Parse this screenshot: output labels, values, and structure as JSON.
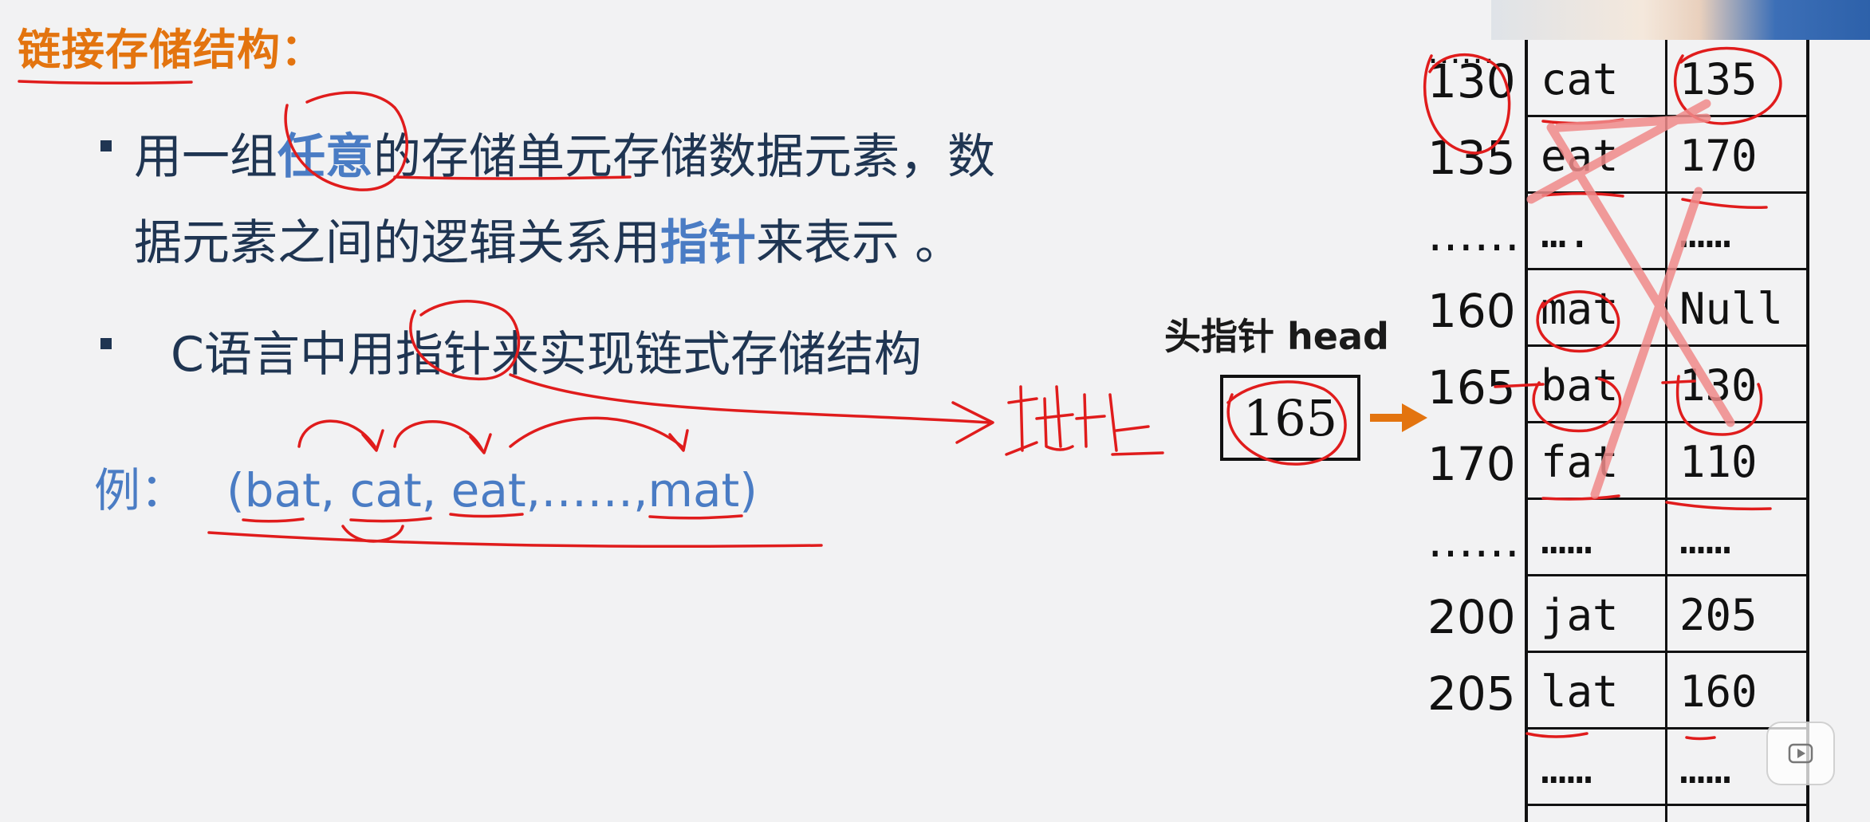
{
  "title": "链接存储结构：",
  "bullets": [
    {
      "line1_pre": "用一组",
      "line1_hl": "任意",
      "line1_post": "的存储单元存储数据元素，数",
      "line2_pre": "据元素之间的逻辑关系用",
      "line2_hl": "指针",
      "line2_post": "来表示 。"
    },
    {
      "text": "C语言中用指针来实现链式存储结构"
    }
  ],
  "example": {
    "label": "例：",
    "list": "(bat, cat, eat,……,mat)"
  },
  "annotation": "地址",
  "head": {
    "label": "头指针 head",
    "value": "165"
  },
  "memory": {
    "top_ellipsis": "……",
    "rows": [
      {
        "addr": "130",
        "data": "cat",
        "next": "135"
      },
      {
        "addr": "135",
        "data": "eat",
        "next": "170"
      },
      {
        "addr": "……",
        "data": "….",
        "next": "……"
      },
      {
        "addr": "160",
        "data": "mat",
        "next": "Null"
      },
      {
        "addr": "165",
        "data": "bat",
        "next": "130"
      },
      {
        "addr": "170",
        "data": "fat",
        "next": "110"
      },
      {
        "addr": "……",
        "data": "……",
        "next": "……"
      },
      {
        "addr": "200",
        "data": "jat",
        "next": "205"
      },
      {
        "addr": "205",
        "data": "lat",
        "next": "160"
      },
      {
        "addr": "",
        "data": "……",
        "next": "……"
      }
    ]
  },
  "colors": {
    "title": "#e3740f",
    "text": "#1f3552",
    "highlight": "#4a7cc4",
    "ink": "#e01c1c",
    "cross": "#f08a8a",
    "arrow": "#e3740f"
  }
}
